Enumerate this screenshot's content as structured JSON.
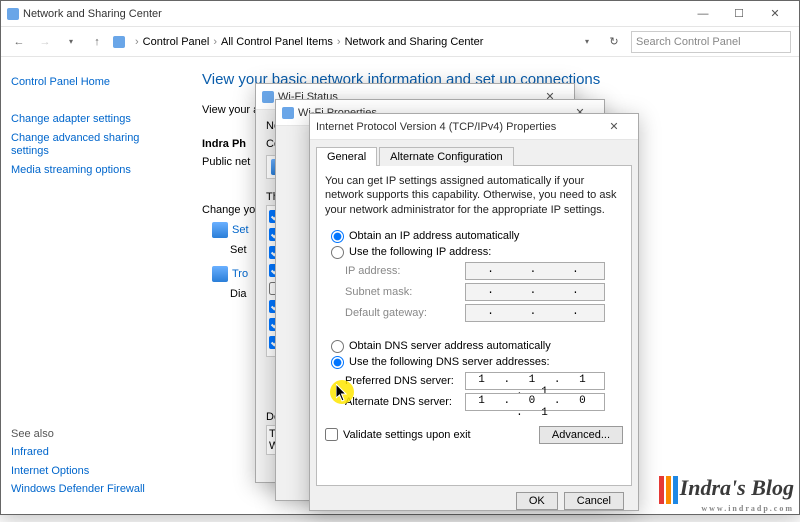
{
  "main": {
    "title": "Network and Sharing Center",
    "breadcrumb": [
      "Control Panel",
      "All Control Panel Items",
      "Network and Sharing Center"
    ],
    "search_placeholder": "Search Control Panel",
    "sidebar": {
      "home": "Control Panel Home",
      "links": [
        "Change adapter settings",
        "Change advanced sharing settings",
        "Media streaming options"
      ],
      "see_also_hdr": "See also",
      "see_also": [
        "Infrared",
        "Internet Options",
        "Windows Defender Firewall"
      ]
    },
    "content": {
      "h1": "View your basic network information and set up connections",
      "view_active": "View your act",
      "name": "Indra Ph",
      "nettype": "Public net",
      "sec2": "Netwo",
      "conn": "Conn",
      "change": "Change your",
      "set": "Set",
      "set_sub": "Set",
      "tro": "Tro",
      "dia": "Dia",
      "de": "De",
      "th": "Th",
      "w": "W"
    }
  },
  "wifistatus": {
    "title": "Wi-Fi Status"
  },
  "wifiprops": {
    "title": "Wi-Fi Properties",
    "this_label": "This"
  },
  "ipv4": {
    "title": "Internet Protocol Version 4 (TCP/IPv4) Properties",
    "tabs": [
      "General",
      "Alternate Configuration"
    ],
    "help": "You can get IP settings assigned automatically if your network supports this capability. Otherwise, you need to ask your network administrator for the appropriate IP settings.",
    "radio_ip_auto": "Obtain an IP address automatically",
    "radio_ip_manual": "Use the following IP address:",
    "ip_labels": {
      "ip": "IP address:",
      "mask": "Subnet mask:",
      "gw": "Default gateway:"
    },
    "radio_dns_auto": "Obtain DNS server address automatically",
    "radio_dns_manual": "Use the following DNS server addresses:",
    "dns_labels": {
      "pref": "Preferred DNS server:",
      "alt": "Alternate DNS server:"
    },
    "dns_values": {
      "pref": "1 . 1 . 1 . 1",
      "alt": "1 . 0 . 0 . 1"
    },
    "validate": "Validate settings upon exit",
    "advanced": "Advanced...",
    "ok": "OK",
    "cancel": "Cancel"
  }
}
